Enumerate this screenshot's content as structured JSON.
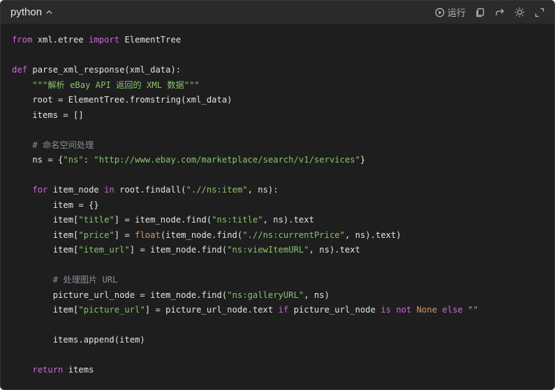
{
  "header": {
    "language": "python",
    "run_label": "运行"
  },
  "code_lines": [
    [
      [
        "kw",
        "from"
      ],
      [
        "pl",
        " xml.etree "
      ],
      [
        "kw",
        "import"
      ],
      [
        "pl",
        " ElementTree"
      ]
    ],
    [],
    [
      [
        "kw",
        "def"
      ],
      [
        "pl",
        " parse_xml_response(xml_data):"
      ]
    ],
    [
      [
        "pl",
        "    "
      ],
      [
        "str",
        "\"\"\"解析 eBay API 返回的 XML 数据\"\"\""
      ]
    ],
    [
      [
        "pl",
        "    root = ElementTree.fromstring(xml_data)"
      ]
    ],
    [
      [
        "pl",
        "    items = []"
      ]
    ],
    [],
    [
      [
        "pl",
        "    "
      ],
      [
        "cm",
        "# 命名空间处理"
      ]
    ],
    [
      [
        "pl",
        "    ns = {"
      ],
      [
        "str",
        "\"ns\""
      ],
      [
        "pl",
        ": "
      ],
      [
        "str",
        "\"http://www.ebay.com/marketplace/search/v1/services\""
      ],
      [
        "pl",
        "}"
      ]
    ],
    [],
    [
      [
        "pl",
        "    "
      ],
      [
        "kw",
        "for"
      ],
      [
        "pl",
        " item_node "
      ],
      [
        "kw",
        "in"
      ],
      [
        "pl",
        " root.findall("
      ],
      [
        "str",
        "\".//ns:item\""
      ],
      [
        "pl",
        ", ns):"
      ]
    ],
    [
      [
        "pl",
        "        item = {}"
      ]
    ],
    [
      [
        "pl",
        "        item["
      ],
      [
        "str",
        "\"title\""
      ],
      [
        "pl",
        "] = item_node.find("
      ],
      [
        "str",
        "\"ns:title\""
      ],
      [
        "pl",
        ", ns).text"
      ]
    ],
    [
      [
        "pl",
        "        item["
      ],
      [
        "str",
        "\"price\""
      ],
      [
        "pl",
        "] = "
      ],
      [
        "num",
        "float"
      ],
      [
        "pl",
        "(item_node.find("
      ],
      [
        "str",
        "\".//ns:currentPrice\""
      ],
      [
        "pl",
        ", ns).text)"
      ]
    ],
    [
      [
        "pl",
        "        item["
      ],
      [
        "str",
        "\"item_url\""
      ],
      [
        "pl",
        "] = item_node.find("
      ],
      [
        "str",
        "\"ns:viewItemURL\""
      ],
      [
        "pl",
        ", ns).text"
      ]
    ],
    [],
    [
      [
        "pl",
        "        "
      ],
      [
        "cm",
        "# 处理图片 URL"
      ]
    ],
    [
      [
        "pl",
        "        picture_url_node = item_node.find("
      ],
      [
        "str",
        "\"ns:galleryURL\""
      ],
      [
        "pl",
        ", ns)"
      ]
    ],
    [
      [
        "pl",
        "        item["
      ],
      [
        "str",
        "\"picture_url\""
      ],
      [
        "pl",
        "] = picture_url_node.text "
      ],
      [
        "kw",
        "if"
      ],
      [
        "pl",
        " picture_url_node "
      ],
      [
        "kw",
        "is not"
      ],
      [
        "pl",
        " "
      ],
      [
        "num",
        "None"
      ],
      [
        "pl",
        " "
      ],
      [
        "kw",
        "else"
      ],
      [
        "pl",
        " "
      ],
      [
        "str",
        "\"\""
      ]
    ],
    [],
    [
      [
        "pl",
        "        items.append(item)"
      ]
    ],
    [],
    [
      [
        "pl",
        "    "
      ],
      [
        "kw",
        "return"
      ],
      [
        "pl",
        " items"
      ]
    ]
  ]
}
